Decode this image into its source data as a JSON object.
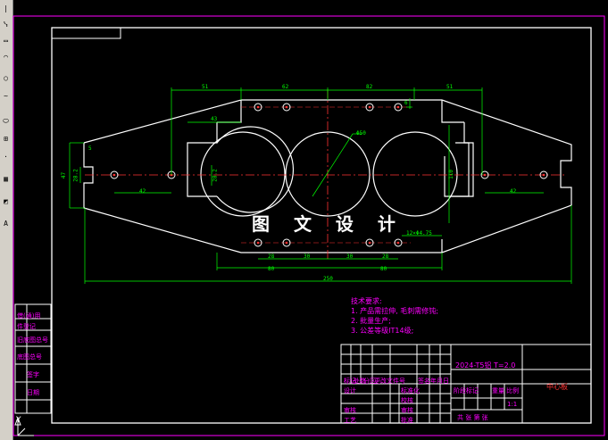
{
  "toolbar": {
    "buttons": [
      "line-icon",
      "polyline-icon",
      "rect-icon",
      "arc-icon",
      "circle-icon",
      "spline-icon",
      "ellipse-icon",
      "block-icon",
      "point-icon",
      "hatch-icon",
      "region-icon",
      "text-icon"
    ]
  },
  "drawing": {
    "watermark": "图 文 设 计",
    "dimensions": {
      "d51_left": "51",
      "d62": "62",
      "d82": "82",
      "d51_right": "51",
      "d43_top": "43",
      "d650": "Φ50",
      "d42_left": "42",
      "d42_right": "42",
      "d47": "47",
      "d28": "28.2",
      "d28b": "28.2",
      "d110": "110",
      "d12": "12×Φ4.75",
      "d28_bot": "28",
      "d30": "30",
      "d30b": "30",
      "d28c": "28",
      "d80": "80",
      "d80b": "80",
      "d250": "250",
      "d5": "5",
      "d6": "6"
    },
    "notes": {
      "title": "技术要求:",
      "line1": "1. 产品需拉伸, 毛刺需修钝;",
      "line2": "2. 批量生产;",
      "line3": "3. 公差等级IT14级;"
    },
    "title_block": {
      "part_code": "2024-T5铝 T=2.0",
      "part_name": "中心板",
      "header_row": [
        "标记",
        "处数",
        "分区",
        "更改文件号",
        "签名",
        "年月日"
      ],
      "row_design": "设计",
      "row_standard": "标准化",
      "row_review": "审核",
      "row_craft": "工艺",
      "row_approve": "批准",
      "stage_labels": [
        "阶段标记",
        "重量",
        "比例"
      ],
      "scale": "1:1",
      "sheet": "共  张  第  张",
      "col_labels": [
        "校核",
        "审核",
        "批准"
      ]
    },
    "side_table": {
      "rows": [
        "借(通)用件登记",
        "旧底图总号",
        "底图总号",
        "签字",
        "日期"
      ],
      "tokens": [
        "借(通)用",
        "件登记",
        "旧底图总号",
        "底图总号",
        "签字",
        "日期"
      ]
    },
    "ucs_label": "Y"
  }
}
